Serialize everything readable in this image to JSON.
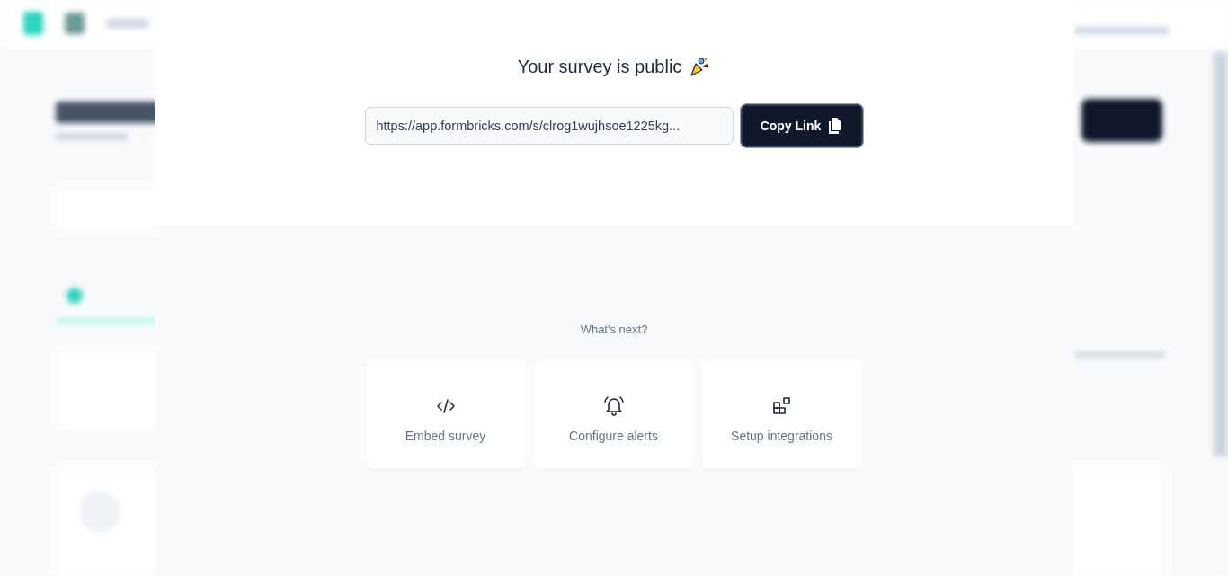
{
  "dialog": {
    "title": "Your survey is public",
    "link": {
      "value": "https://app.formbricks.com/s/clrog1wujhsoe1225kg..."
    },
    "copy_button": "Copy Link",
    "next_heading": "What's next?",
    "actions": [
      {
        "kind": "embed",
        "label": "Embed survey"
      },
      {
        "kind": "alerts",
        "label": "Configure alerts"
      },
      {
        "kind": "integrations",
        "label": "Setup integrations"
      }
    ]
  }
}
